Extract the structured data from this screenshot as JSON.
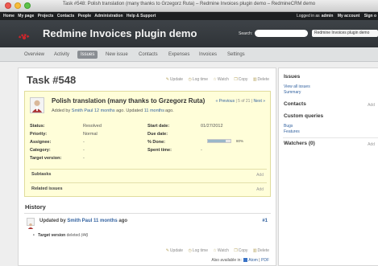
{
  "window": {
    "title": "Task #548: Polish translation (many thanks to Grzegorz Ruta) – Redmine Invoices plugin demo – RedmineCRM demo"
  },
  "top_menu": {
    "items": [
      "Home",
      "My page",
      "Projects",
      "Contacts",
      "People",
      "Administration",
      "Help & Support"
    ],
    "logged_in_prefix": "Logged in as",
    "logged_in_user": "admin",
    "my_account": "My account",
    "sign_out": "Sign o"
  },
  "header": {
    "project_title": "Redmine Invoices plugin demo",
    "search_label": "Search:",
    "search_value": "",
    "project_jump": "Redmine Invoices plugin demo"
  },
  "main_menu": {
    "tabs": [
      "Overview",
      "Activity",
      "Issues",
      "New issue",
      "Contacts",
      "Expenses",
      "Invoices",
      "Settings"
    ],
    "selected": "Issues"
  },
  "issue": {
    "title": "Task #548",
    "actions": [
      "Update",
      "Log time",
      "Watch",
      "Copy",
      "Delete"
    ],
    "subject": "Polish translation (many thanks to Grzegorz Ruta)",
    "added_prefix": "Added by",
    "author": "Smith Paul",
    "added_ago": "12 months",
    "added_mid": "ago. Updated",
    "updated_ago": "11 months",
    "updated_suffix": "ago.",
    "pagination": {
      "previous": "« Previous",
      "count": "| 5 of 21 |",
      "next": "Next »"
    },
    "attributes_left": [
      {
        "label": "Status:",
        "value": "Resolved"
      },
      {
        "label": "Priority:",
        "value": "Normal"
      },
      {
        "label": "Assignee:",
        "value": "-"
      },
      {
        "label": "Category:",
        "value": "-"
      },
      {
        "label": "Target version:",
        "value": "-"
      }
    ],
    "attributes_right": [
      {
        "label": "Start date:",
        "value": "01/27/2012"
      },
      {
        "label": "Due date:",
        "value": ""
      },
      {
        "label": "% Done:",
        "value": ""
      },
      {
        "label": "Spent time:",
        "value": "-"
      }
    ],
    "done_percent": 80,
    "done_label": "80%",
    "subtasks_label": "Subtasks",
    "related_label": "Related issues",
    "add_label": "Add"
  },
  "history": {
    "title": "History",
    "entry": {
      "prefix": "Updated by",
      "author": "Smith Paul",
      "ago": "11 months",
      "suffix": "ago",
      "number": "#1",
      "detail_field": "Target version",
      "detail_text": "deleted",
      "detail_value": "(44)"
    }
  },
  "footer": {
    "also_available": "Also available in:",
    "atom": "Atom",
    "separator": "|",
    "pdf": "PDF"
  },
  "sidebar": {
    "issues_title": "Issues",
    "view_all": "View all issues",
    "summary": "Summary",
    "contacts_title": "Contacts",
    "contacts_add": "Add",
    "custom_queries_title": "Custom queries",
    "queries": [
      "Bugs",
      "Features"
    ],
    "watchers_title": "Watchers (0)",
    "watchers_add": "Add"
  },
  "colors": {
    "accent_link": "#3463a0",
    "issue_box": "#fffed9",
    "selected_tab": "#8a8e93",
    "header_bg": "#3a3e43",
    "logo_red": "#c8262c"
  }
}
